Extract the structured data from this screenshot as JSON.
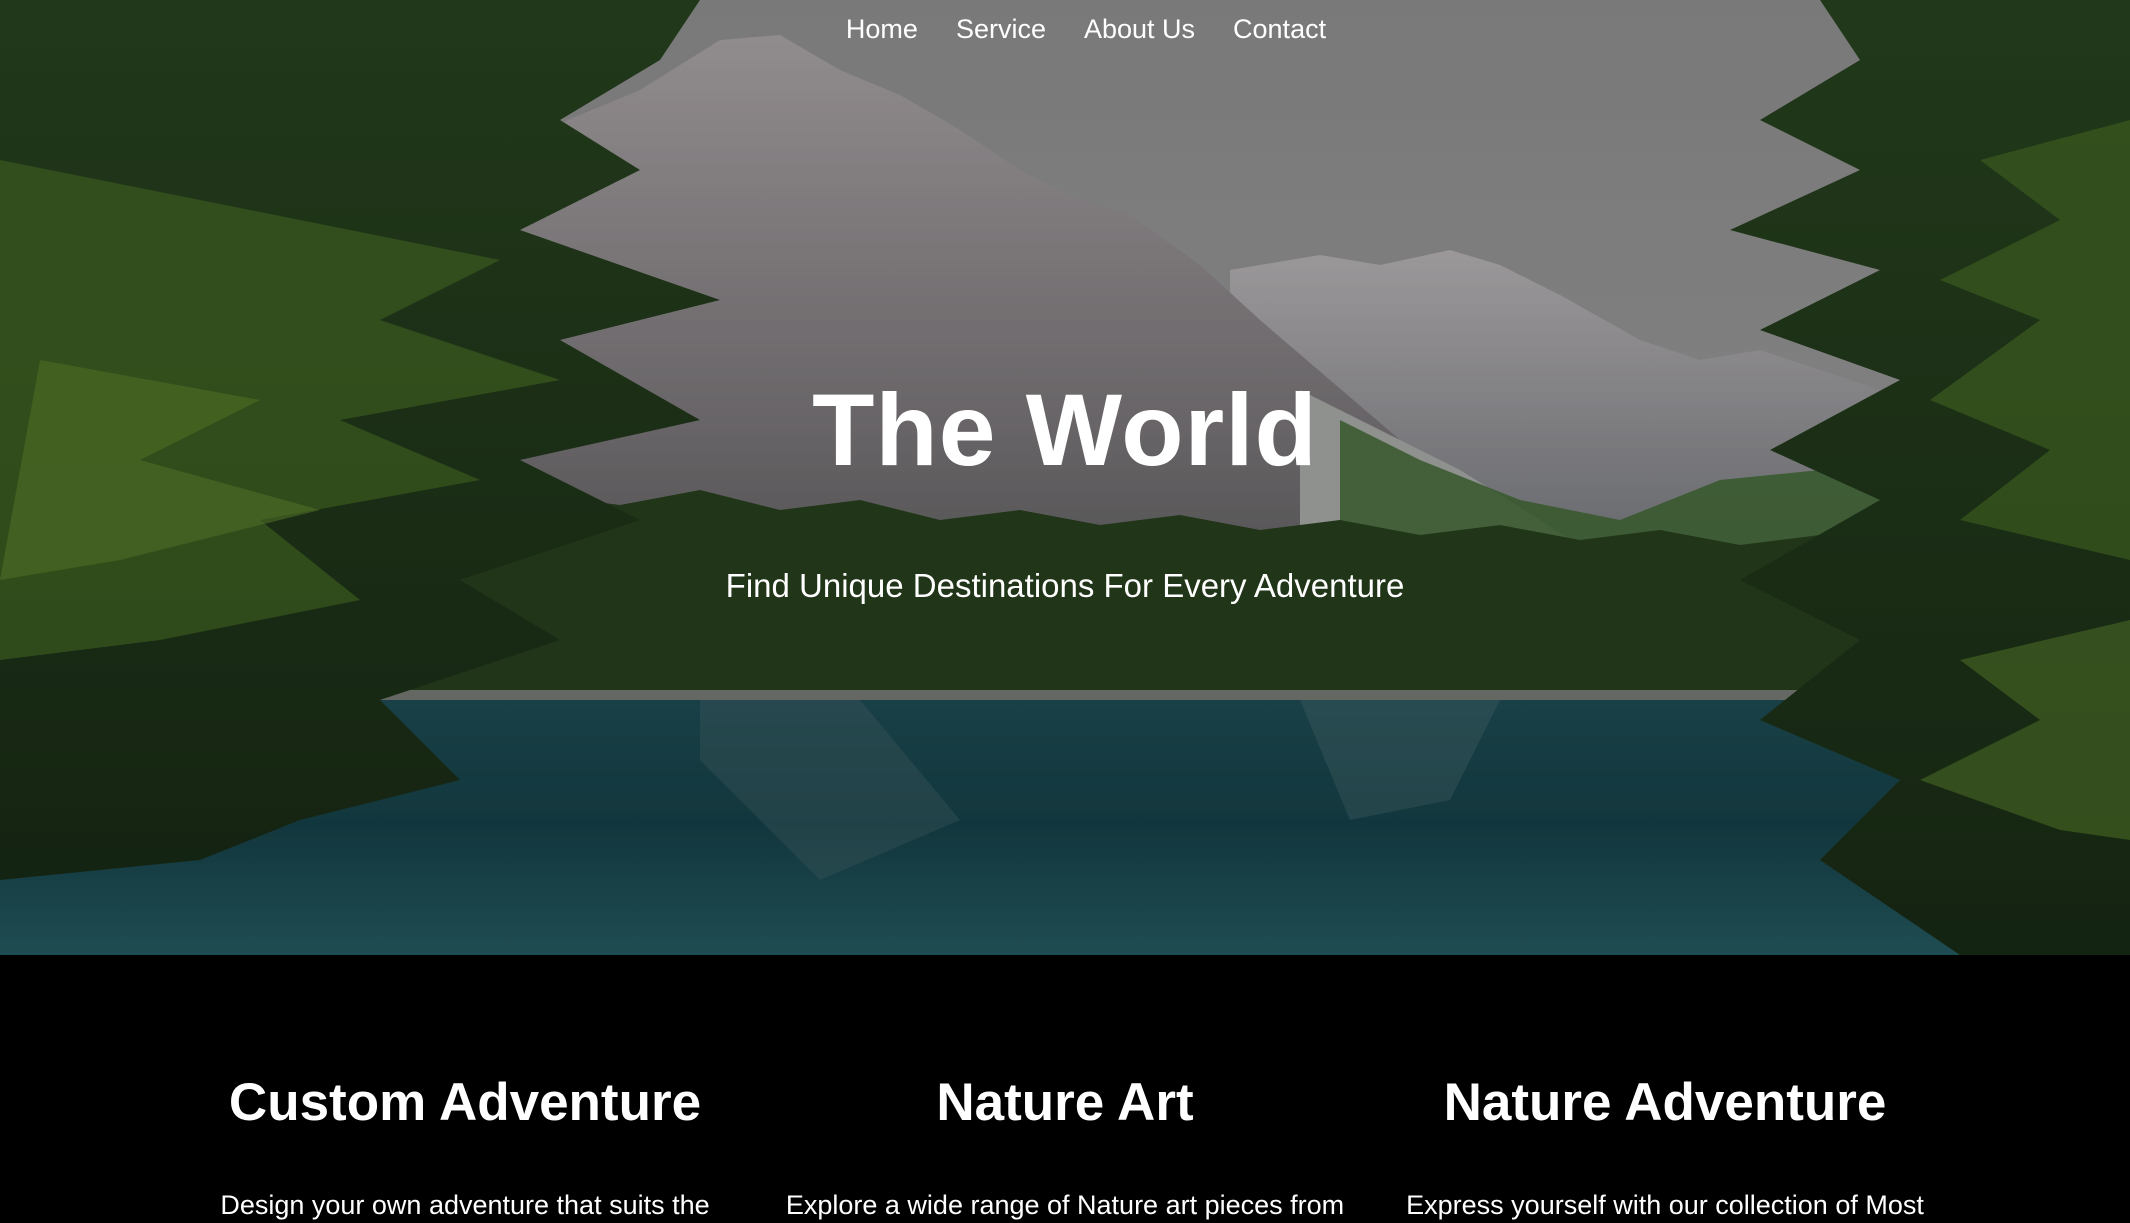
{
  "nav": {
    "items": [
      {
        "label": "Home"
      },
      {
        "label": "Service"
      },
      {
        "label": "About Us"
      },
      {
        "label": "Contact"
      }
    ]
  },
  "hero": {
    "title": "The World",
    "subtitle": "Find Unique Destinations For Every Adventure"
  },
  "features": [
    {
      "title": "Custom Adventure",
      "text": "Design your own adventure that suits the"
    },
    {
      "title": "Nature Art",
      "text": "Explore a wide range of Nature art pieces from"
    },
    {
      "title": "Nature Adventure",
      "text": "Express yourself with our collection of Most"
    }
  ],
  "colors": {
    "background": "#000000",
    "text": "#ffffff",
    "lake": "#1f5a63",
    "forest": "#3f6a1f"
  }
}
